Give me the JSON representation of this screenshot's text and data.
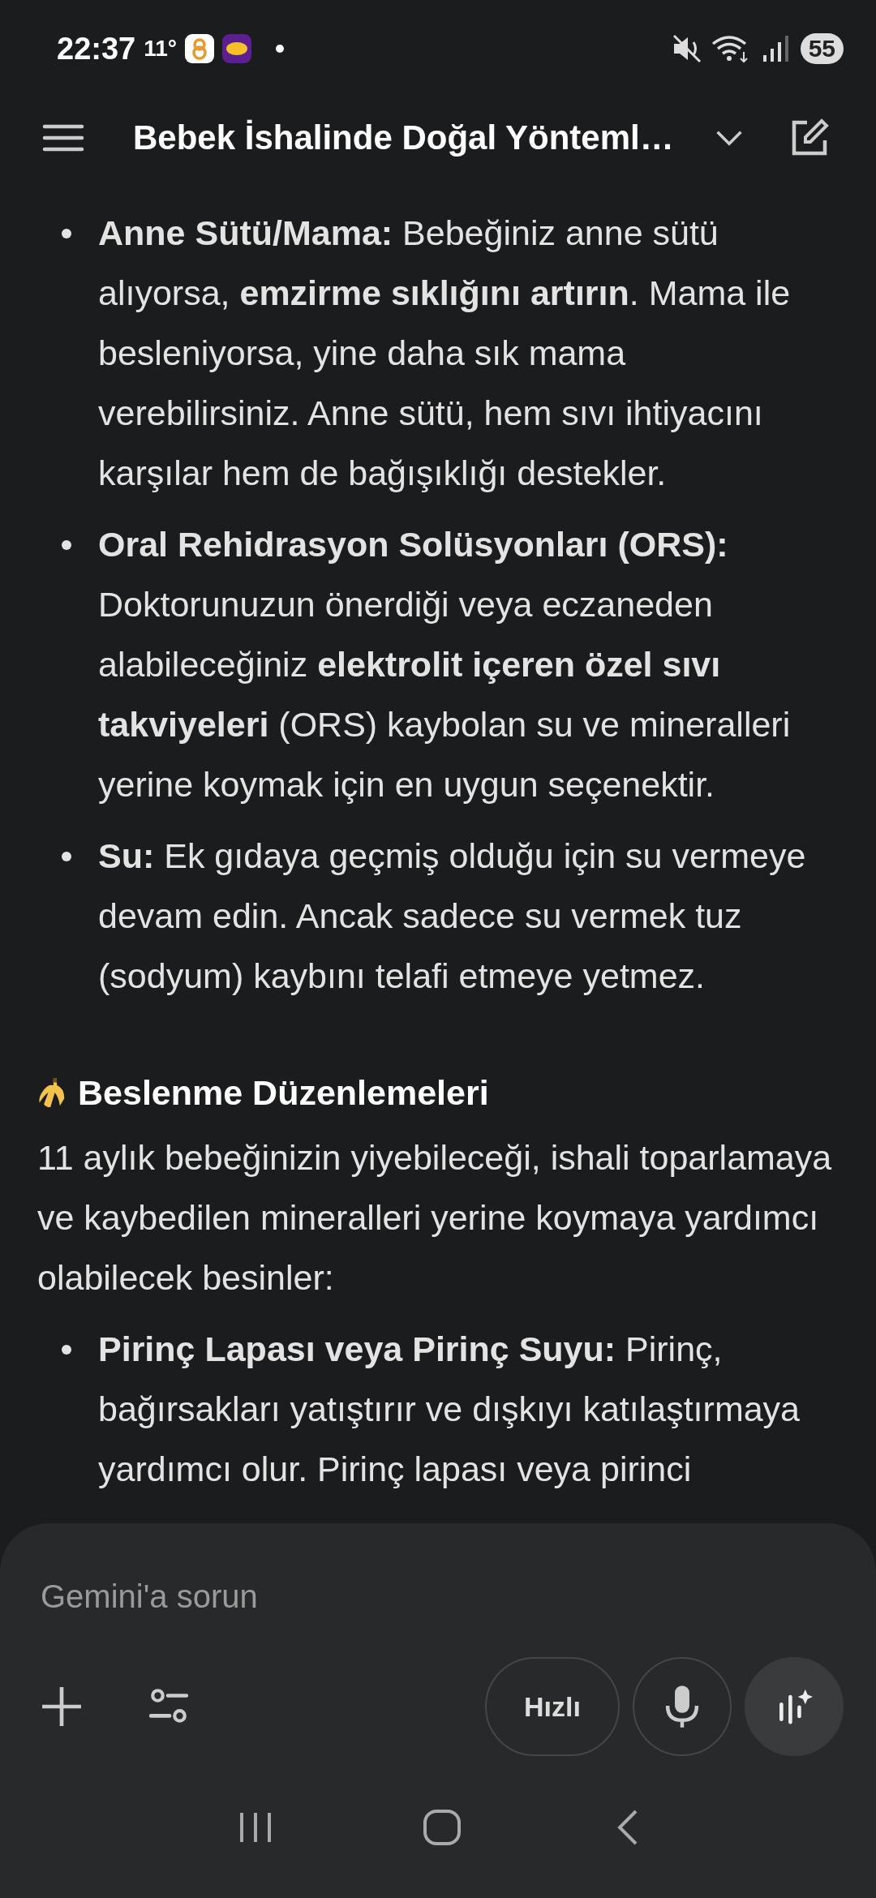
{
  "status_bar": {
    "time": "22:37",
    "temperature": "11°",
    "battery": "55"
  },
  "header": {
    "title": "Bebek İshalinde Doğal Yönteml…"
  },
  "content": [
    {
      "kind": "bullets",
      "items": [
        "**Anne Sütü/Mama:** Bebeğiniz anne sütü alıyorsa, **emzirme sıklığını artırın**. Mama ile besleniyorsa, yine daha sık mama verebilirsiniz. Anne sütü, hem sıvı ihtiyacını karşılar hem de bağışıklığı destekler.",
        "**Oral Rehidrasyon Solüsyonları (ORS):** Doktorunuzun önerdiği veya eczaneden alabileceğiniz **elektrolit içeren özel sıvı takviyeleri** (ORS) kaybolan su ve mineralleri yerine koymak için en uygun seçenektir.",
        "**Su:** Ek gıdaya geçmiş olduğu için su vermeye devam edin. Ancak sadece su vermek tuz (sodyum) kaybını telafi etmeye yetmez."
      ]
    },
    {
      "kind": "heading",
      "text": "Beslenme Düzenlemeleri"
    },
    {
      "kind": "paragraph",
      "text": "11 aylık bebeğinizin yiyebileceği, ishali toparlamaya ve kaybedilen mineralleri yerine koymaya yardımcı olabilecek besinler:"
    },
    {
      "kind": "bullets",
      "items": [
        "**Pirinç Lapası veya Pirinç Suyu:** Pirinç, bağırsakları yatıştırır ve dışkıyı katılaştırmaya yardımcı olur. Pirinç lapası veya pirinci"
      ]
    }
  ],
  "composer": {
    "placeholder": "Gemini'a sorun",
    "mode": "Hızlı"
  }
}
